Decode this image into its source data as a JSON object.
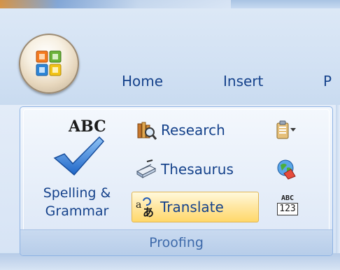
{
  "tabs": [
    "Home",
    "Insert",
    "P"
  ],
  "group": {
    "caption": "Proofing",
    "spelling": {
      "line1": "Spelling &",
      "line2": "Grammar",
      "icon_text": "ABC"
    },
    "research": {
      "label": "Research"
    },
    "thesaurus": {
      "label": "Thesaurus"
    },
    "translate": {
      "label": "Translate"
    },
    "word_count_icon": {
      "top": "ABC",
      "bottom": "123"
    }
  },
  "icons": {
    "office_button": "office-logo",
    "spelling": "abc-check-icon",
    "research": "research-books-icon",
    "thesaurus": "thesaurus-book-icon",
    "translate": "translate-icon",
    "clipboard": "clipboard-dropdown-icon",
    "language": "globe-language-icon",
    "word_count": "word-count-icon"
  },
  "colors": {
    "tab_text": "#15428b",
    "caption_text": "#3e6aaa",
    "highlight": "#ffd86a"
  }
}
